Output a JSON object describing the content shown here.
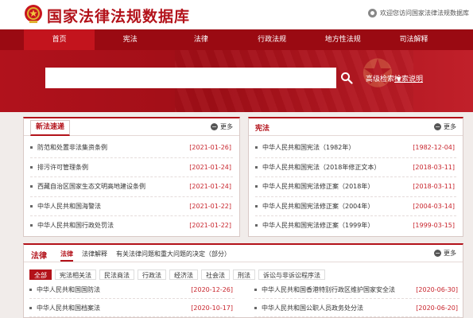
{
  "header": {
    "title": "国家法律法规数据库",
    "welcome": "欢迎您访问国家法律法规数据库"
  },
  "nav": {
    "items": [
      "首页",
      "宪法",
      "法律",
      "行政法规",
      "地方性法规",
      "司法解释"
    ]
  },
  "search": {
    "value": "",
    "advanced_label": "高级检索",
    "help_label": "检索说明"
  },
  "latest": {
    "tab": "新法速递",
    "more": "更多",
    "items": [
      {
        "title": "防范和处置非法集资条例",
        "date": "[2021-01-26]"
      },
      {
        "title": "排污许可管理条例",
        "date": "[2021-01-24]"
      },
      {
        "title": "西藏自治区国家生态文明高地建设条例",
        "date": "[2021-01-24]"
      },
      {
        "title": "中华人民共和国海警法",
        "date": "[2021-01-22]"
      },
      {
        "title": "中华人民共和国行政处罚法",
        "date": "[2021-01-22]"
      }
    ]
  },
  "constitution": {
    "title": "宪法",
    "more": "更多",
    "items": [
      {
        "title": "中华人民共和国宪法（1982年）",
        "date": "[1982-12-04]"
      },
      {
        "title": "中华人民共和国宪法（2018年修正文本）",
        "date": "[2018-03-11]"
      },
      {
        "title": "中华人民共和国宪法修正案（2018年）",
        "date": "[2018-03-11]"
      },
      {
        "title": "中华人民共和国宪法修正案（2004年）",
        "date": "[2004-03-14]"
      },
      {
        "title": "中华人民共和国宪法修正案（1999年）",
        "date": "[1999-03-15]"
      }
    ]
  },
  "law": {
    "title": "法律",
    "more": "更多",
    "tabs": [
      "法律",
      "法律解释",
      "有关法律问题和重大问题的决定（部分）"
    ],
    "chips": [
      "全部",
      "宪法相关法",
      "民法商法",
      "行政法",
      "经济法",
      "社会法",
      "刑法",
      "诉讼与非诉讼程序法"
    ],
    "left_items": [
      {
        "title": "中华人民共和国国防法",
        "date": "[2020-12-26]"
      },
      {
        "title": "中华人民共和国档案法",
        "date": "[2020-10-17]"
      }
    ],
    "right_items": [
      {
        "title": "中华人民共和国香港特别行政区维护国家安全法",
        "date": "[2020-06-30]"
      },
      {
        "title": "中华人民共和国公职人员政务处分法",
        "date": "[2020-06-20]"
      }
    ]
  },
  "colors": {
    "brand_red": "#b3121a",
    "nav_red": "#9a0a12",
    "date_red": "#c8252d"
  }
}
